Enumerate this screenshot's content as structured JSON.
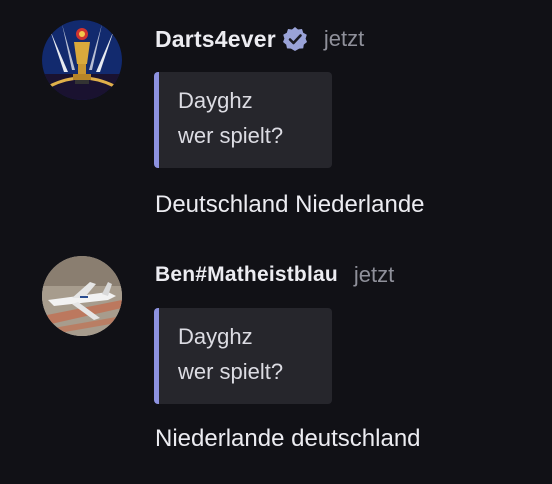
{
  "messages": [
    {
      "username": "Darts4ever",
      "verified": true,
      "timestamp": "jetzt",
      "avatar_icon": "darts-trophy-avatar",
      "reply": {
        "author": "Dayghz",
        "text": "wer spielt?"
      },
      "text": "Deutschland Niederlande"
    },
    {
      "username": "Ben#Matheistblau",
      "verified": false,
      "timestamp": "jetzt",
      "avatar_icon": "airplane-avatar",
      "reply": {
        "author": "Dayghz",
        "text": "wer spielt?"
      },
      "text": "Niederlande deutschland"
    }
  ],
  "colors": {
    "background": "#111116",
    "quote_background": "#26262c",
    "quote_accent": "#8d92e0",
    "verified_badge": "#9aa3d8",
    "timestamp": "#8f909a"
  }
}
